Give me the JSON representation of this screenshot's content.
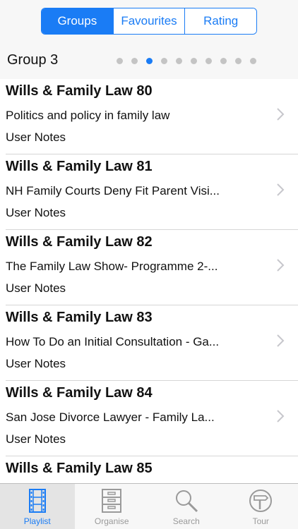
{
  "segments": [
    {
      "label": "Groups",
      "active": true
    },
    {
      "label": "Favourites",
      "active": false
    },
    {
      "label": "Rating",
      "active": false
    }
  ],
  "group": {
    "title": "Group 3",
    "page_count": 10,
    "current_page": 3
  },
  "rows": [
    {
      "title": "Wills & Family Law 80",
      "subtitle": "Politics and policy in family law",
      "notes": "User Notes"
    },
    {
      "title": "Wills & Family Law 81",
      "subtitle": "NH Family Courts Deny Fit Parent Visi...",
      "notes": "User Notes"
    },
    {
      "title": "Wills & Family Law 82",
      "subtitle": "The Family Law Show- Programme 2-...",
      "notes": "User Notes"
    },
    {
      "title": "Wills & Family Law 83",
      "subtitle": "How To Do an Initial Consultation - Ga...",
      "notes": "User Notes"
    },
    {
      "title": "Wills & Family Law 84",
      "subtitle": "San Jose Divorce Lawyer - Family La...",
      "notes": "User Notes"
    },
    {
      "title": "Wills & Family Law 85",
      "subtitle": "",
      "notes": ""
    }
  ],
  "tabs": [
    {
      "label": "Playlist",
      "icon": "film-icon",
      "active": true
    },
    {
      "label": "Organise",
      "icon": "cabinet-icon",
      "active": false
    },
    {
      "label": "Search",
      "icon": "magnifier-icon",
      "active": false
    },
    {
      "label": "Tour",
      "icon": "signpost-icon",
      "active": false
    }
  ],
  "colors": {
    "accent": "#1a7cf5",
    "inactive_tab": "#9a9a9a",
    "dot_inactive": "#c4c4c4"
  }
}
